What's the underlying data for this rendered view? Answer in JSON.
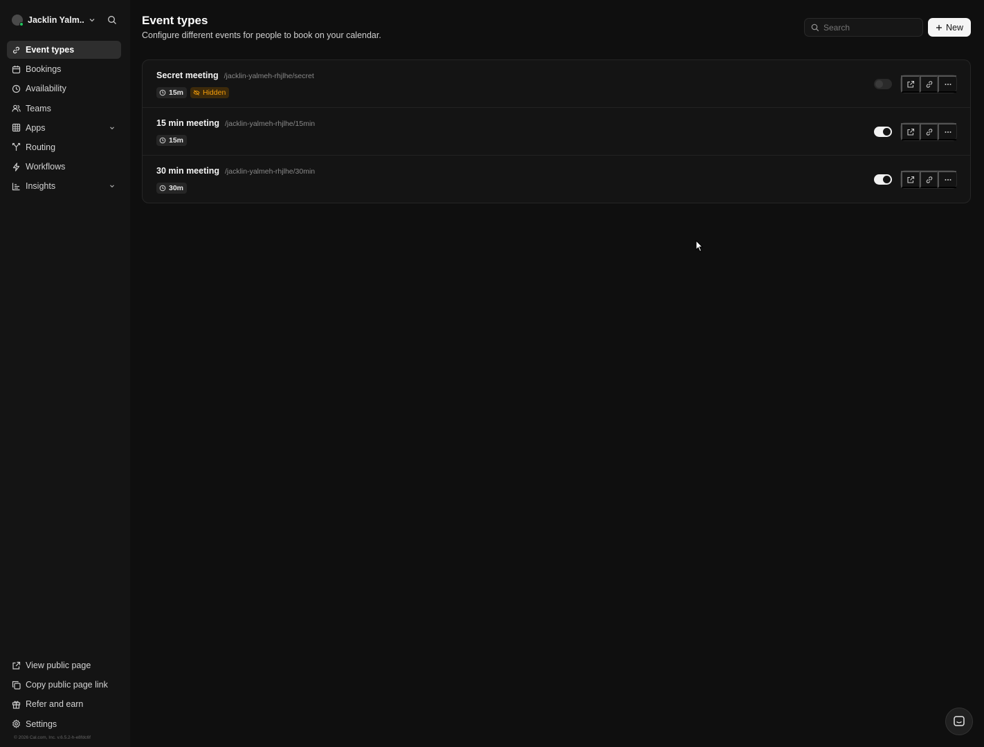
{
  "user": {
    "name": "Jacklin Yalm..."
  },
  "nav": {
    "items": [
      {
        "label": "Event types",
        "icon": "link-icon",
        "active": true
      },
      {
        "label": "Bookings",
        "icon": "calendar-icon"
      },
      {
        "label": "Availability",
        "icon": "clock-icon"
      },
      {
        "label": "Teams",
        "icon": "users-icon"
      },
      {
        "label": "Apps",
        "icon": "grid-icon",
        "expandable": true
      },
      {
        "label": "Routing",
        "icon": "split-icon"
      },
      {
        "label": "Workflows",
        "icon": "zap-icon"
      },
      {
        "label": "Insights",
        "icon": "chart-icon",
        "expandable": true
      }
    ],
    "bottom": [
      {
        "label": "View public page",
        "icon": "external-link-icon"
      },
      {
        "label": "Copy public page link",
        "icon": "copy-icon"
      },
      {
        "label": "Refer and earn",
        "icon": "gift-icon"
      },
      {
        "label": "Settings",
        "icon": "gear-icon"
      }
    ],
    "footer": "© 2026 Cal.com, Inc. v.6.5.2-h-e8fdc6f"
  },
  "header": {
    "title": "Event types",
    "subtitle": "Configure different events for people to book on your calendar.",
    "search_placeholder": "Search",
    "new_label": "New"
  },
  "events": [
    {
      "title": "Secret meeting",
      "slug": "/jacklin-yalmeh-rhjlhe/secret",
      "duration": "15m",
      "hidden_label": "Hidden",
      "enabled": false
    },
    {
      "title": "15 min meeting",
      "slug": "/jacklin-yalmeh-rhjlhe/15min",
      "duration": "15m",
      "enabled": true
    },
    {
      "title": "30 min meeting",
      "slug": "/jacklin-yalmeh-rhjlhe/30min",
      "duration": "30m",
      "enabled": true
    }
  ],
  "colors": {
    "background": "#0f0f0f",
    "sidebar": "#141414",
    "hidden_badge": "#f59e0b",
    "online": "#22c55e"
  }
}
